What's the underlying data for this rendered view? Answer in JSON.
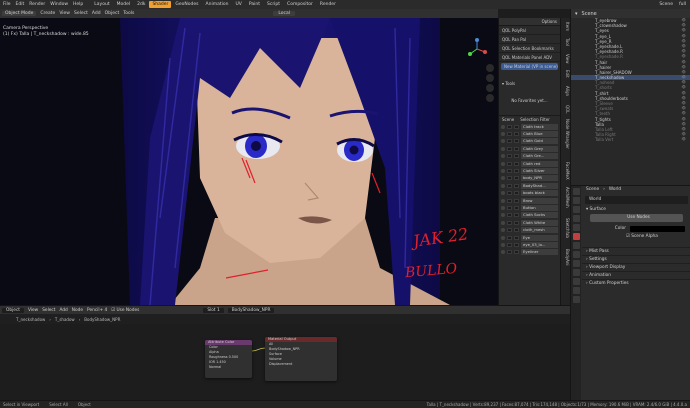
{
  "topbar": {
    "menus": [
      "File",
      "Edit",
      "Render",
      "Window",
      "Help"
    ],
    "workspaces": [
      "Layout",
      "Model",
      "2dk",
      "Shader",
      "GeoNodes",
      "Animation",
      "UV",
      "Paint",
      "Script",
      "Compositor",
      "Render"
    ],
    "active_workspace": "Shader",
    "scene": "Scene",
    "view_layer": "full"
  },
  "viewport_toolbar": {
    "mode": "Object Mode",
    "menus": [
      "Create",
      "View",
      "Select",
      "Add",
      "Object",
      "Tools"
    ],
    "orientation": "Local"
  },
  "viewport": {
    "camera_label": "Camera Perspective",
    "object_label": "(1) Fx) Talla | T_neckshadow : wide.85",
    "signature_line1": "JAK 22",
    "signature_line2": "BULLO"
  },
  "npanel": {
    "options_label": "Options",
    "addons": [
      "QOL PolyPal",
      "QOL Pan Pal",
      "QOL Selection Bookmarks",
      "QOL Materials Panel ADV"
    ],
    "new_material_label": "New Material (VP in scene)",
    "tools_label": "Tools",
    "favorites_label": "No Favorites yet...",
    "scene_label": "Scene",
    "selection_filter_label": "Selection Filter",
    "materials": [
      "Cloth track",
      "Cloth Blue",
      "Cloth Gold",
      "Cloth Grey",
      "Cloth Gre...",
      "Cloth red",
      "Cloth Silver",
      "body_NPR",
      "BodyShad...",
      "boots black",
      "Brow",
      "Button",
      "Cloth Socks",
      "Cloth White",
      "cloth_mesh",
      "Eye",
      "eye_03_lo...",
      "Eyeliner"
    ]
  },
  "sidetabs": [
    "Item",
    "Tool",
    "View",
    "Edit",
    "Align",
    "QOL",
    "Node Wrangler",
    "FaceMeX",
    "ArchiMesh",
    "Sketchfab",
    "BodyAni",
    "Animation",
    "Node"
  ],
  "outliner": {
    "header": "Scene",
    "items": [
      {
        "name": "T_eyebrow",
        "sel": false,
        "dim": false
      },
      {
        "name": "T_crownshadow",
        "sel": false,
        "dim": false
      },
      {
        "name": "T_eyes",
        "sel": false,
        "dim": false
      },
      {
        "name": "T_eye_L",
        "sel": false,
        "dim": false
      },
      {
        "name": "T_eye_R",
        "sel": false,
        "dim": false
      },
      {
        "name": "T_eyeshade.L",
        "sel": false,
        "dim": false
      },
      {
        "name": "T_eyeshade.R",
        "sel": false,
        "dim": false
      },
      {
        "name": "T_eyeshade.R",
        "sel": false,
        "dim": true
      },
      {
        "name": "T_hair",
        "sel": false,
        "dim": false
      },
      {
        "name": "T_hairer",
        "sel": false,
        "dim": false
      },
      {
        "name": "T_hairer_SHADOW",
        "sel": false,
        "dim": false
      },
      {
        "name": "T_neckshadow",
        "sel": true,
        "dim": false
      },
      {
        "name": "T_nohead",
        "sel": false,
        "dim": true
      },
      {
        "name": "T_shorts",
        "sel": false,
        "dim": true
      },
      {
        "name": "T_shirt",
        "sel": false,
        "dim": false
      },
      {
        "name": "T_shoulderboots",
        "sel": false,
        "dim": false
      },
      {
        "name": "T_Sleeve",
        "sel": false,
        "dim": true
      },
      {
        "name": "T_sweats",
        "sel": false,
        "dim": true
      },
      {
        "name": "T_teeth",
        "sel": false,
        "dim": true
      },
      {
        "name": "T_tights",
        "sel": false,
        "dim": false
      },
      {
        "name": "Talla",
        "sel": false,
        "dim": false
      },
      {
        "name": "Talla Left",
        "sel": false,
        "dim": true
      },
      {
        "name": "Talla Right",
        "sel": false,
        "dim": true
      },
      {
        "name": "Talla Vert",
        "sel": false,
        "dim": true
      }
    ]
  },
  "properties": {
    "scene": "Scene",
    "world_tab": "World",
    "world_name": "World",
    "surface_label": "Surface",
    "use_nodes_label": "Use Nodes",
    "color_label": "Color",
    "scene_alpha_label": "Scene Alpha",
    "sections": [
      "Mist Pass",
      "Settings",
      "Viewport Display",
      "Animation",
      "Custom Properties"
    ]
  },
  "node_editor": {
    "type": "Object",
    "menus": [
      "View",
      "Select",
      "Add",
      "Node",
      "Pencil+ 4"
    ],
    "use_nodes_label": "Use Nodes",
    "slot": "Slot 1",
    "material": "BodyShadow_NPR",
    "breadcrumb": [
      "T_neckshadow",
      "T_shadow",
      "BodyShadow_NPR"
    ],
    "node1": {
      "title": "Attribute Color",
      "rows": [
        "Color",
        "Alpha",
        "Roughness 0.500",
        "IOR 1.450",
        "Normal"
      ]
    },
    "node2": {
      "title": "Material Output",
      "rows": [
        "All",
        "BodyShadow_NPR",
        "Surface",
        "Volume",
        "Displacement"
      ]
    }
  },
  "statusbar": {
    "left": [
      "Select in Viewport",
      "Select All",
      "Object"
    ],
    "right": "Talla | T_neckshadow | Verts:89,237 | Faces:87,074 | Tris:174,148 | Objects:1/73 | Memory: 190.6 MiB | VRAM: 2.4/6.0 GiB | 4.4.0.a"
  },
  "colors": {
    "accent": "#f0a030",
    "hair": "#1a1470",
    "skin": "#d9b49b",
    "eye": "#2a2ac8",
    "signature": "#e0202a"
  }
}
